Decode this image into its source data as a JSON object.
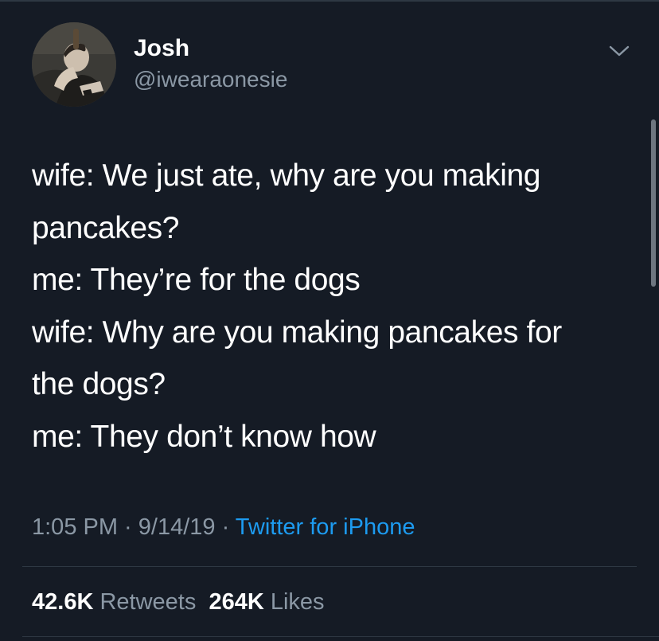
{
  "user": {
    "display_name": "Josh",
    "handle": "@iwearaonesie",
    "avatar_icon": "profile-photo"
  },
  "tweet": {
    "lines": [
      "wife: We just ate, why are you making",
      "pancakes?",
      "me: They’re for the dogs",
      "wife: Why are you making pancakes for",
      "the dogs?",
      "me: They don’t know how"
    ]
  },
  "meta": {
    "time": "1:05 PM",
    "separator": " · ",
    "date": "9/14/19",
    "source": "Twitter for iPhone"
  },
  "stats": {
    "retweets_count": "42.6K",
    "retweets_label": "Retweets",
    "likes_count": "264K",
    "likes_label": "Likes"
  },
  "colors": {
    "background": "#151b25",
    "primary_text": "#ffffff",
    "secondary_text": "#8b98a5",
    "link": "#1d9bf0",
    "divider": "#2e3843"
  },
  "icons": {
    "menu": "chevron-down-icon"
  }
}
